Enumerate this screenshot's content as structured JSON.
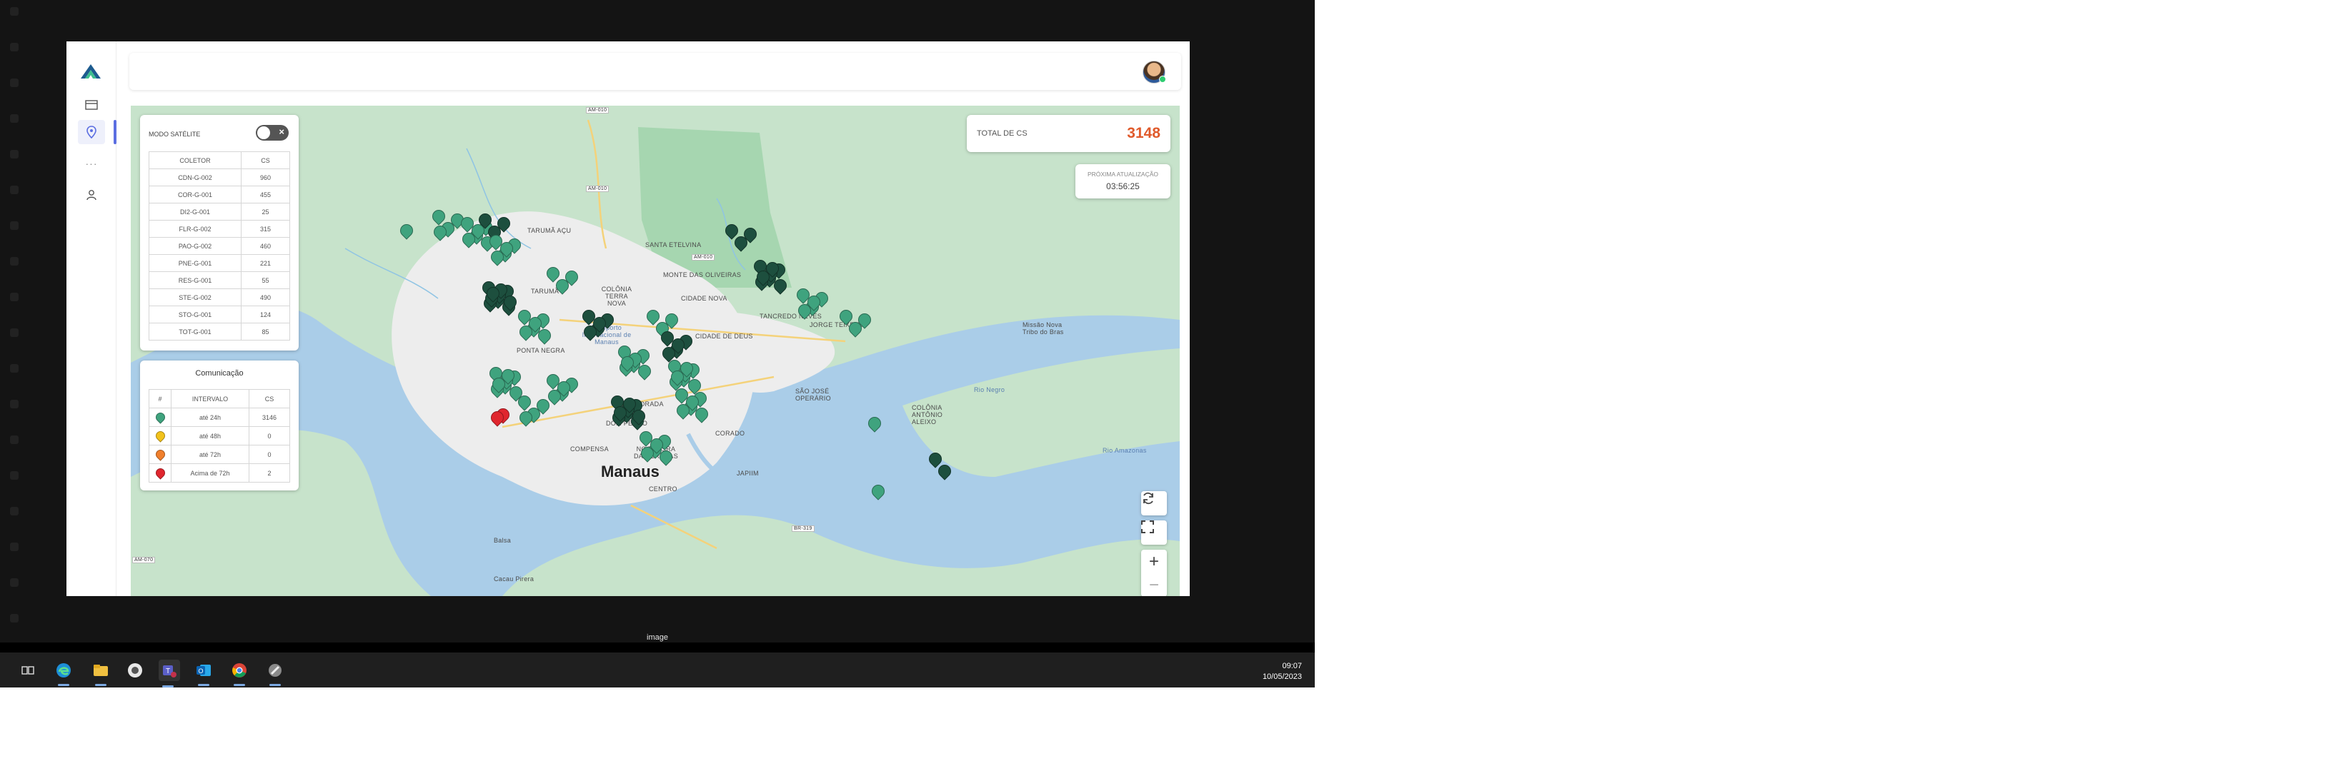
{
  "viewer": {
    "caption": "image"
  },
  "map": {
    "labels": [
      "TARUMÃ AÇU",
      "TARUMÃ",
      "COLÔNIA TERRA NOVA",
      "SANTA ETELVINA",
      "MONTE DAS OLIVEIRAS",
      "CIDADE NOVA",
      "CIDADE DE DEUS",
      "TANCREDO NEVES",
      "JORGE TEIXEIRA",
      "SÃO JOSÉ OPERÁRIO",
      "COLÔNIA ANTÔNIO ALEIXO",
      "ALVORADA",
      "DOM PEDRO",
      "CORADO",
      "COMPENSA",
      "NOSSA SRA DAS GRAÇAS",
      "JAPIIM",
      "CENTRO",
      "PONTA NEGRA",
      "Aeroporto Internacional de Manaus",
      "Missão Nova Tribo do Bras",
      "Rio Negro",
      "Rio Amazonas",
      "Manaus",
      "Balsa",
      "Cacau Pirera"
    ],
    "road_labels": [
      "AM-010",
      "AM-010",
      "AM-010",
      "BR-319",
      "AM-070"
    ],
    "marker_colors": {
      "green": "#3fa37e",
      "dark_green": "#1d4f3e",
      "red": "#e0262e",
      "yellow": "#f2c21b",
      "orange": "#f07f2c"
    }
  },
  "satellite": {
    "label": "MODO SATÉLITE",
    "enabled": false
  },
  "collectors": {
    "headers": [
      "COLETOR",
      "CS"
    ],
    "rows": [
      [
        "CDN-G-002",
        "960"
      ],
      [
        "COR-G-001",
        "455"
      ],
      [
        "DI2-G-001",
        "25"
      ],
      [
        "FLR-G-002",
        "315"
      ],
      [
        "PAO-G-002",
        "460"
      ],
      [
        "PNE-G-001",
        "221"
      ],
      [
        "RES-G-001",
        "55"
      ],
      [
        "STE-G-002",
        "490"
      ],
      [
        "STO-G-001",
        "124"
      ],
      [
        "TOT-G-001",
        "85"
      ]
    ]
  },
  "communication": {
    "title": "Comunicação",
    "headers": [
      "#",
      "INTERVALO",
      "CS"
    ],
    "rows": [
      {
        "color": "#3fa37e",
        "interval": "até 24h",
        "cs": "3146"
      },
      {
        "color": "#f2c21b",
        "interval": "até 48h",
        "cs": "0"
      },
      {
        "color": "#f07f2c",
        "interval": "até 72h",
        "cs": "0"
      },
      {
        "color": "#e0262e",
        "interval": "Acima de 72h",
        "cs": "2"
      }
    ]
  },
  "total": {
    "label": "TOTAL DE CS",
    "value": "3148"
  },
  "next_update": {
    "label": "PRÓXIMA ATUALIZAÇÃO",
    "time": "03:56:25"
  },
  "map_controls": {
    "refresh": "refresh-icon",
    "fullscreen": "fullscreen-icon",
    "zoom_in": "+",
    "zoom_out": "−"
  },
  "taskbar": {
    "apps": [
      "task-view-icon",
      "edge-icon",
      "file-explorer-icon",
      "settings-app-icon",
      "teams-icon",
      "outlook-icon",
      "chrome-icon",
      "tool-icon"
    ],
    "time": "09:07",
    "date": "10/05/2023"
  }
}
